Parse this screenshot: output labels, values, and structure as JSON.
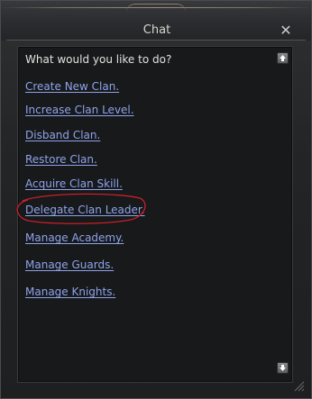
{
  "window": {
    "title": "Chat",
    "close_glyph": "✕"
  },
  "dialog": {
    "prompt": "What would you like to do?",
    "options": [
      {
        "label": "Create New Clan."
      },
      {
        "label": "Increase Clan Level."
      },
      {
        "label": "Disband Clan."
      },
      {
        "label": "Restore Clan."
      },
      {
        "label": "Acquire Clan Skill."
      },
      {
        "label": "Delegate Clan Leader."
      },
      {
        "label": "Manage Academy."
      },
      {
        "label": "Manage Guards."
      },
      {
        "label": "Manage Knights."
      }
    ],
    "highlighted_option": "Delegate Clan Leader."
  },
  "icons": {
    "scroll_up": "arrow-up-icon",
    "scroll_down": "arrow-down-icon",
    "close": "close-icon"
  },
  "colors": {
    "link": "#8fa3ea",
    "highlight_ring": "#c8202a",
    "panel_bg": "#17191b",
    "text": "#e2e2dd"
  }
}
